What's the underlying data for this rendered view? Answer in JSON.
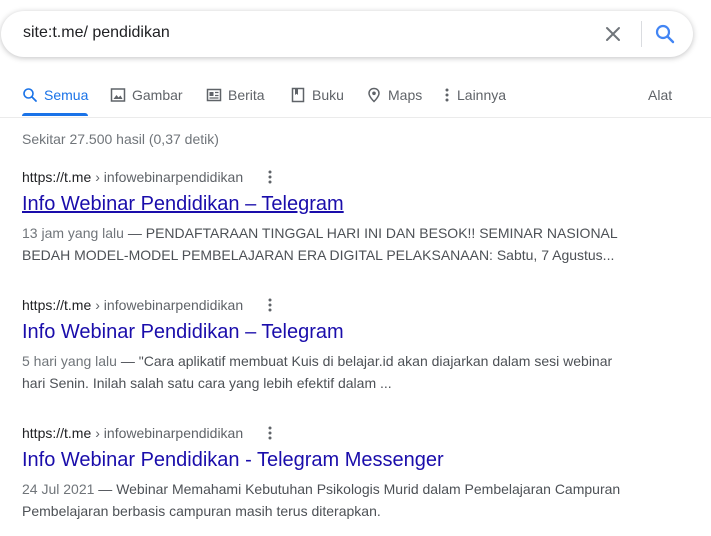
{
  "search": {
    "query": "site:t.me/ pendidikan"
  },
  "icons": {
    "clear": "close-icon",
    "search": "search-icon",
    "more": "vertical-dots-icon"
  },
  "colors": {
    "link": "#1a0dab",
    "accent": "#1a73e8",
    "snippet": "#4d5156"
  },
  "tabs": [
    {
      "label": "Semua",
      "icon": "search-icon",
      "active": true
    },
    {
      "label": "Gambar",
      "icon": "image-icon"
    },
    {
      "label": "Berita",
      "icon": "news-icon"
    },
    {
      "label": "Buku",
      "icon": "book-icon"
    },
    {
      "label": "Maps",
      "icon": "map-pin-icon"
    },
    {
      "label": "Lainnya",
      "icon": "vertical-dots-icon"
    }
  ],
  "tools_label": "Alat",
  "stats": "Sekitar 27.500 hasil (0,37 detik)",
  "results": [
    {
      "host": "https://t.me",
      "path": "› infowebinarpendidikan",
      "title": "Info Webinar Pendidikan – Telegram",
      "date": "13 jam yang lalu",
      "sep": " — ",
      "snippet": "PENDAFTARAAN TINGGAL HARI INI DAN BESOK!! SEMINAR NASIONAL BEDAH MODEL-MODEL PEMBELAJARAN ERA DIGITAL PELAKSANAAN: Sabtu, 7 Agustus..."
    },
    {
      "host": "https://t.me",
      "path": "› infowebinarpendidikan",
      "title": "Info Webinar Pendidikan – Telegram",
      "date": "5 hari yang lalu",
      "sep": " — ",
      "snippet": "\"Cara aplikatif membuat Kuis di belajar.id akan diajarkan dalam sesi webinar hari Senin. Inilah salah satu cara yang lebih efektif dalam ..."
    },
    {
      "host": "https://t.me",
      "path": "› infowebinarpendidikan",
      "title": "Info Webinar Pendidikan - Telegram Messenger",
      "date": "24 Jul 2021",
      "sep": " — ",
      "snippet": "Webinar Memahami Kebutuhan Psikologis Murid dalam Pembelajaran Campuran Pembelajaran berbasis campuran masih terus diterapkan."
    }
  ]
}
